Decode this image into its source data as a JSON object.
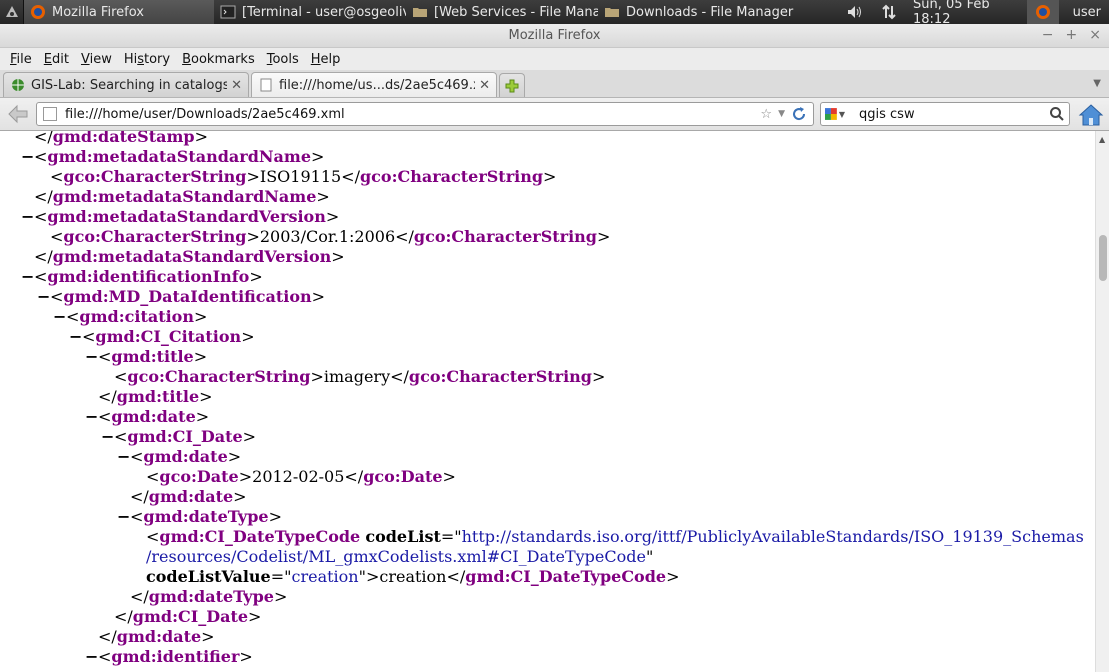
{
  "taskbar": {
    "tasks": [
      {
        "label": "Mozilla Firefox"
      },
      {
        "label": "[Terminal - user@osgeoliv..."
      },
      {
        "label": "[Web Services - File Manag..."
      },
      {
        "label": "Downloads - File Manager"
      }
    ],
    "clock": "Sun, 05 Feb  18:12",
    "user": "user"
  },
  "window": {
    "title": "Mozilla Firefox"
  },
  "menu": {
    "items": [
      {
        "label": "File",
        "key": "F",
        "rest": "ile"
      },
      {
        "label": "Edit",
        "key": "E",
        "rest": "dit"
      },
      {
        "label": "View",
        "key": "V",
        "rest": "iew"
      },
      {
        "label": "History",
        "pre": "Hi",
        "key": "s",
        "rest": "tory"
      },
      {
        "label": "Bookmarks",
        "key": "B",
        "rest": "ookmarks"
      },
      {
        "label": "Tools",
        "key": "T",
        "rest": "ools"
      },
      {
        "label": "Help",
        "key": "H",
        "rest": "elp"
      }
    ]
  },
  "tabs": [
    {
      "label": "GIS-Lab: Searching in catalogs w..."
    },
    {
      "label": "file:///home/us...ds/2ae5c469.xml"
    }
  ],
  "nav": {
    "url": "file:///home/user/Downloads/2ae5c469.xml",
    "search_value": "qgis csw"
  },
  "xml": {
    "lines": [
      {
        "indent": 0,
        "minus": false,
        "parts": [
          [
            "p",
            "</"
          ],
          [
            "t",
            "gmd:dateStamp"
          ],
          [
            "p",
            ">"
          ]
        ]
      },
      {
        "indent": 0,
        "minus": true,
        "parts": [
          [
            "p",
            "<"
          ],
          [
            "t",
            "gmd:metadataStandardName"
          ],
          [
            "p",
            ">"
          ]
        ]
      },
      {
        "indent": 1,
        "minus": false,
        "parts": [
          [
            "p",
            "<"
          ],
          [
            "t",
            "gco:CharacterString"
          ],
          [
            "p",
            ">ISO19115</"
          ],
          [
            "t",
            "gco:CharacterString"
          ],
          [
            "p",
            ">"
          ]
        ]
      },
      {
        "indent": 0,
        "minus": false,
        "parts": [
          [
            "p",
            "</"
          ],
          [
            "t",
            "gmd:metadataStandardName"
          ],
          [
            "p",
            ">"
          ]
        ]
      },
      {
        "indent": 0,
        "minus": true,
        "parts": [
          [
            "p",
            "<"
          ],
          [
            "t",
            "gmd:metadataStandardVersion"
          ],
          [
            "p",
            ">"
          ]
        ]
      },
      {
        "indent": 1,
        "minus": false,
        "parts": [
          [
            "p",
            "<"
          ],
          [
            "t",
            "gco:CharacterString"
          ],
          [
            "p",
            ">2003/Cor.1:2006</"
          ],
          [
            "t",
            "gco:CharacterString"
          ],
          [
            "p",
            ">"
          ]
        ]
      },
      {
        "indent": 0,
        "minus": false,
        "parts": [
          [
            "p",
            "</"
          ],
          [
            "t",
            "gmd:metadataStandardVersion"
          ],
          [
            "p",
            ">"
          ]
        ]
      },
      {
        "indent": 0,
        "minus": true,
        "parts": [
          [
            "p",
            "<"
          ],
          [
            "t",
            "gmd:identificationInfo"
          ],
          [
            "p",
            ">"
          ]
        ]
      },
      {
        "indent": 1,
        "minus": true,
        "parts": [
          [
            "p",
            "<"
          ],
          [
            "t",
            "gmd:MD_DataIdentification"
          ],
          [
            "p",
            ">"
          ]
        ]
      },
      {
        "indent": 2,
        "minus": true,
        "parts": [
          [
            "p",
            "<"
          ],
          [
            "t",
            "gmd:citation"
          ],
          [
            "p",
            ">"
          ]
        ]
      },
      {
        "indent": 3,
        "minus": true,
        "parts": [
          [
            "p",
            "<"
          ],
          [
            "t",
            "gmd:CI_Citation"
          ],
          [
            "p",
            ">"
          ]
        ]
      },
      {
        "indent": 4,
        "minus": true,
        "parts": [
          [
            "p",
            "<"
          ],
          [
            "t",
            "gmd:title"
          ],
          [
            "p",
            ">"
          ]
        ]
      },
      {
        "indent": 5,
        "minus": false,
        "parts": [
          [
            "p",
            "<"
          ],
          [
            "t",
            "gco:CharacterString"
          ],
          [
            "p",
            ">imagery</"
          ],
          [
            "t",
            "gco:CharacterString"
          ],
          [
            "p",
            ">"
          ]
        ]
      },
      {
        "indent": 4,
        "minus": false,
        "parts": [
          [
            "p",
            "</"
          ],
          [
            "t",
            "gmd:title"
          ],
          [
            "p",
            ">"
          ]
        ]
      },
      {
        "indent": 4,
        "minus": true,
        "parts": [
          [
            "p",
            "<"
          ],
          [
            "t",
            "gmd:date"
          ],
          [
            "p",
            ">"
          ]
        ]
      },
      {
        "indent": 5,
        "minus": true,
        "parts": [
          [
            "p",
            "<"
          ],
          [
            "t",
            "gmd:CI_Date"
          ],
          [
            "p",
            ">"
          ]
        ]
      },
      {
        "indent": 6,
        "minus": true,
        "parts": [
          [
            "p",
            "<"
          ],
          [
            "t",
            "gmd:date"
          ],
          [
            "p",
            ">"
          ]
        ]
      },
      {
        "indent": 7,
        "minus": false,
        "parts": [
          [
            "p",
            "<"
          ],
          [
            "t",
            "gco:Date"
          ],
          [
            "p",
            ">2012-02-05</"
          ],
          [
            "t",
            "gco:Date"
          ],
          [
            "p",
            ">"
          ]
        ]
      },
      {
        "indent": 6,
        "minus": false,
        "parts": [
          [
            "p",
            "</"
          ],
          [
            "t",
            "gmd:date"
          ],
          [
            "p",
            ">"
          ]
        ]
      },
      {
        "indent": 6,
        "minus": true,
        "parts": [
          [
            "p",
            "<"
          ],
          [
            "t",
            "gmd:dateType"
          ],
          [
            "p",
            ">"
          ]
        ]
      },
      {
        "indent": 7,
        "minus": false,
        "parts": [
          [
            "p",
            "<"
          ],
          [
            "t",
            "gmd:CI_DateTypeCode"
          ],
          [
            "p",
            " "
          ],
          [
            "a",
            "codeList"
          ],
          [
            "p",
            "=\""
          ],
          [
            "v",
            "http://standards.iso.org/ittf/PubliclyAvailableStandards/ISO_19139_Schemas"
          ]
        ]
      },
      {
        "indent": 7,
        "minus": false,
        "parts": [
          [
            "v",
            "/resources/Codelist/ML_gmxCodelists.xml#CI_DateTypeCode"
          ],
          [
            "p",
            "\""
          ]
        ]
      },
      {
        "indent": 7,
        "minus": false,
        "parts": [
          [
            "a",
            "codeListValue"
          ],
          [
            "p",
            "=\""
          ],
          [
            "v",
            "creation"
          ],
          [
            "p",
            "\">creation</"
          ],
          [
            "t",
            "gmd:CI_DateTypeCode"
          ],
          [
            "p",
            ">"
          ]
        ]
      },
      {
        "indent": 6,
        "minus": false,
        "parts": [
          [
            "p",
            "</"
          ],
          [
            "t",
            "gmd:dateType"
          ],
          [
            "p",
            ">"
          ]
        ]
      },
      {
        "indent": 5,
        "minus": false,
        "parts": [
          [
            "p",
            "</"
          ],
          [
            "t",
            "gmd:CI_Date"
          ],
          [
            "p",
            ">"
          ]
        ]
      },
      {
        "indent": 4,
        "minus": false,
        "parts": [
          [
            "p",
            "</"
          ],
          [
            "t",
            "gmd:date"
          ],
          [
            "p",
            ">"
          ]
        ]
      },
      {
        "indent": 4,
        "minus": true,
        "parts": [
          [
            "p",
            "<"
          ],
          [
            "t",
            "gmd:identifier"
          ],
          [
            "p",
            ">"
          ]
        ]
      }
    ]
  }
}
